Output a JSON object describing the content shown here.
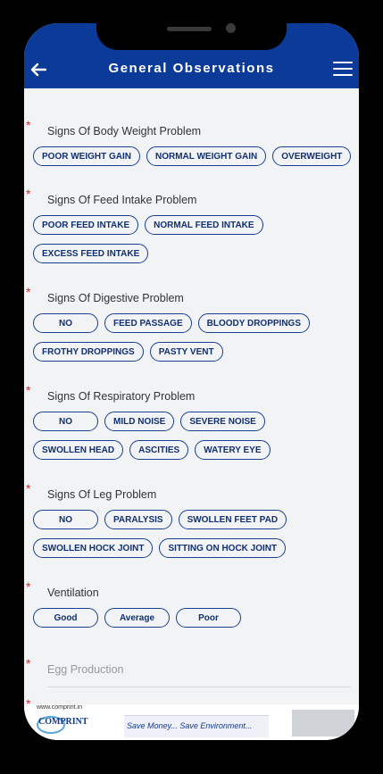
{
  "appbar": {
    "title": "General Observations"
  },
  "sections": [
    {
      "label": "Signs Of Body Weight Problem",
      "options": [
        "POOR WEIGHT GAIN",
        "NORMAL WEIGHT GAIN",
        "OVERWEIGHT"
      ]
    },
    {
      "label": "Signs Of Feed Intake Problem",
      "options": [
        "POOR FEED INTAKE",
        "NORMAL FEED INTAKE",
        "EXCESS FEED INTAKE"
      ]
    },
    {
      "label": "Signs Of Digestive Problem",
      "options": [
        "NO",
        "FEED PASSAGE",
        "BLOODY DROPPINGS",
        "FROTHY DROPPINGS",
        "PASTY VENT"
      ]
    },
    {
      "label": "Signs Of Respiratory Problem",
      "options": [
        "NO",
        "MILD NOISE",
        "SEVERE NOISE",
        "SWOLLEN HEAD",
        "ASCITIES",
        "WATERY EYE"
      ]
    },
    {
      "label": "Signs Of Leg Problem",
      "options": [
        "NO",
        "PARALYSIS",
        "SWOLLEN FEET PAD",
        "SWOLLEN HOCK JOINT",
        "SITTING ON HOCK JOINT"
      ]
    },
    {
      "label": "Ventilation",
      "options": [
        "Good",
        "Average",
        "Poor"
      ]
    }
  ],
  "egg": {
    "label": "Egg Production"
  },
  "required_mark": "*",
  "banner": {
    "url": "www.comprint.in",
    "brand": "COMPRINT",
    "tagline": "Save Money... Save Environment..."
  },
  "colors": {
    "appbar": "#0b3a98",
    "chip_border": "#1b3f8f",
    "required": "#d32f2f"
  }
}
